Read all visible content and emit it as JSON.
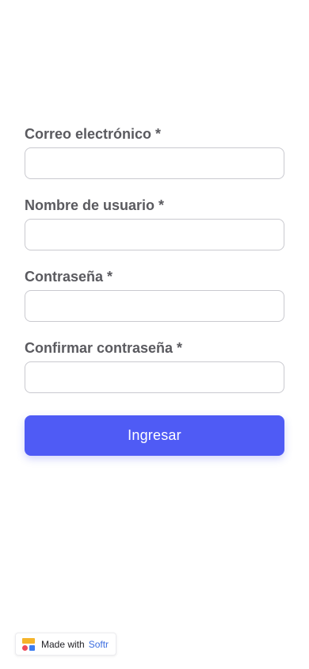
{
  "form": {
    "fields": [
      {
        "label": "Correo electrónico *",
        "value": "",
        "placeholder": ""
      },
      {
        "label": "Nombre de usuario *",
        "value": "",
        "placeholder": ""
      },
      {
        "label": "Contraseña *",
        "value": "",
        "placeholder": ""
      },
      {
        "label": "Confirmar contraseña *",
        "value": "",
        "placeholder": ""
      }
    ],
    "submit_label": "Ingresar"
  },
  "badge": {
    "prefix": "Made with",
    "brand": "Softr",
    "icon": "softr-logo-icon"
  },
  "colors": {
    "primary": "#4f5bf5",
    "brand_text": "#3b6de0",
    "logo_yellow": "#f5b42a",
    "logo_red": "#ef4b5a",
    "logo_blue": "#3c7cf0"
  }
}
